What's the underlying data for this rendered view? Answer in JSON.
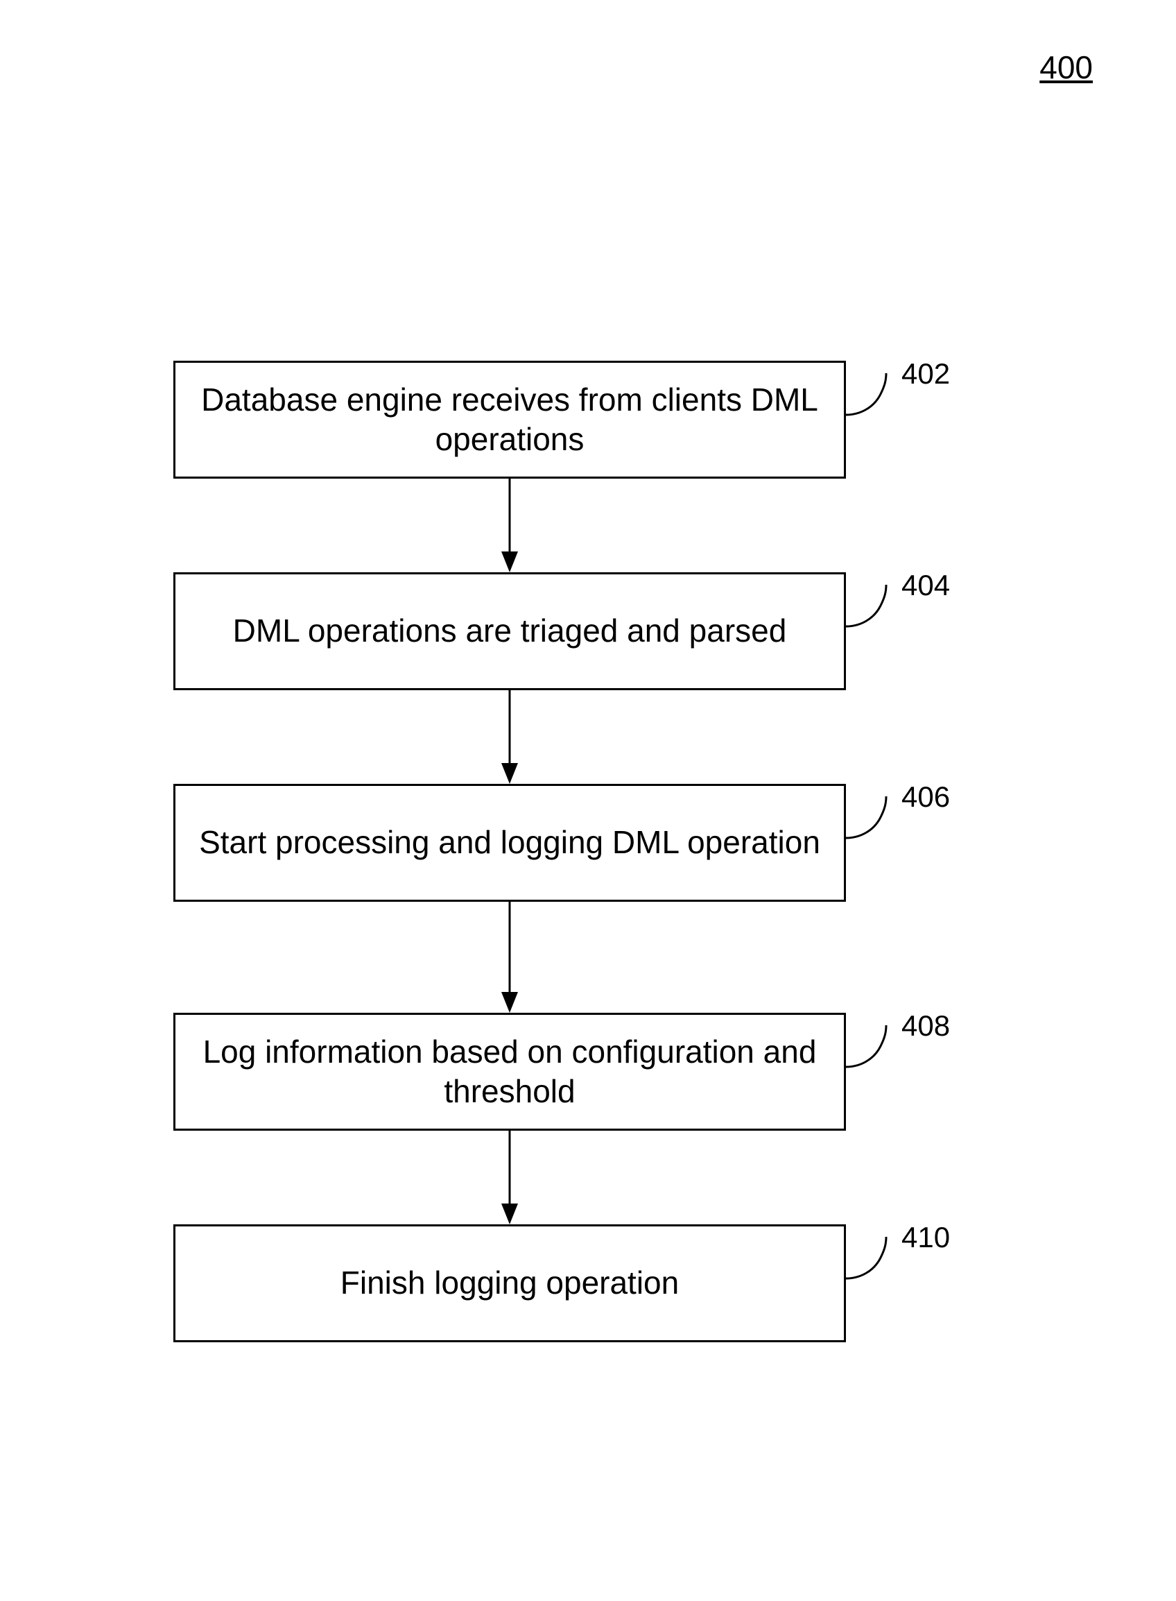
{
  "figure": {
    "number": "400"
  },
  "steps": {
    "s1": {
      "ref": "402",
      "text": "Database engine receives from clients DML operations"
    },
    "s2": {
      "ref": "404",
      "text": "DML operations are triaged and parsed"
    },
    "s3": {
      "ref": "406",
      "text": "Start processing and logging DML operation"
    },
    "s4": {
      "ref": "408",
      "text": "Log information based on configuration and threshold"
    },
    "s5": {
      "ref": "410",
      "text": "Finish logging operation"
    }
  }
}
